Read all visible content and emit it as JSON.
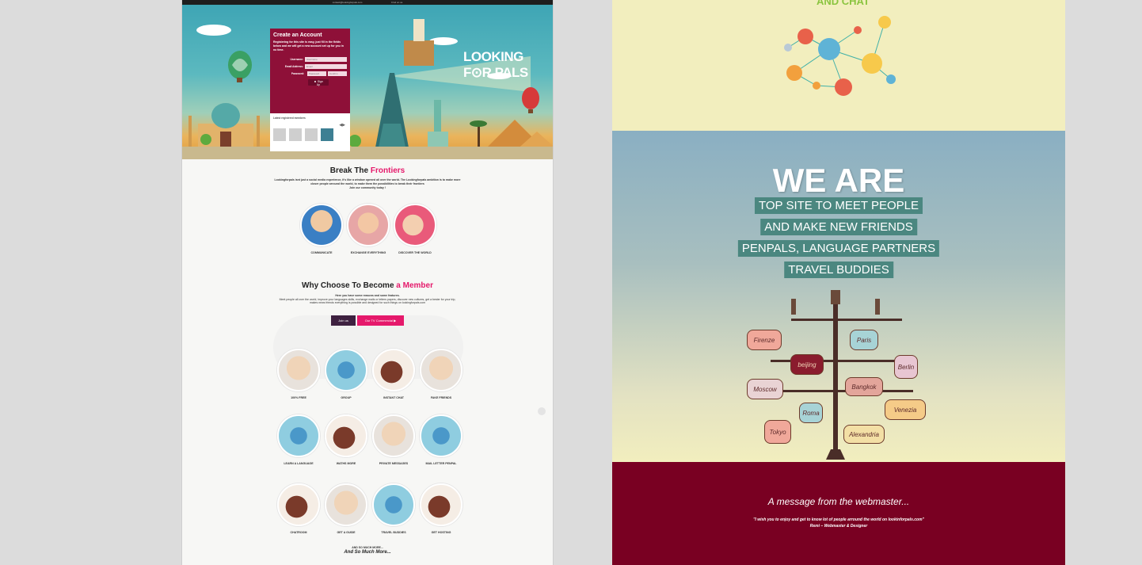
{
  "left_page": {
    "topbar": {
      "email": "contact@lookingforpals.com",
      "find": "Find on us"
    },
    "logo": "LOOKING F⊙R PALS",
    "signup": {
      "title": "Create an Account",
      "intro": "Registering for this site is easy, just fill in the fields below and we will get a new account set up for you in no time.",
      "username_label": "Username:",
      "username_placeholder": "Username",
      "email_label": "Email Address:",
      "email_placeholder": "Email",
      "password_label": "Password:",
      "password_placeholder": "Password",
      "confirm_placeholder": "Confirm",
      "button": "Sign Up"
    },
    "members": {
      "title": "Latest registered members"
    },
    "frontiers": {
      "title_a": "Break The ",
      "title_b": "Frontiers",
      "text": "Lookingforpals isnt just a social media experience, it's like a window opened all over the world. The Lookingforpals ambition is to make more closer people arround the world, to make them the possibilities to break their frontiers",
      "join": "Join our community today !",
      "items": [
        "COMMUNICATE",
        "EXCHANGE EVERYTHING",
        "DISCOVER THE WORLD"
      ]
    },
    "member": {
      "title_a": "Why Choose To Become ",
      "title_b": "a Member",
      "sub": "Here you have some reasons and some features.",
      "text": "Meet people all over the world, improve your languages skills, exchange mails or letters papers, discover new cultures, get a bester for your trip, makes news friends everything is possible and designed for such things on lookingforpals.com",
      "btn_join": "Join us",
      "btn_tv": "Our TV Commercial",
      "features": [
        [
          "100% FREE",
          "GROUP",
          "INSTANT CHAT",
          "FAKE FRIENDS"
        ],
        [
          "LEARN A LANGUAGE",
          "WATHS MORE",
          "PRIVATE MESSAGES",
          "MAIL LETTER PENPAL"
        ],
        [
          "CHATROOM",
          "GET A GUIDE",
          "TRAVEL BUDDIES",
          "GET HOSTING"
        ]
      ],
      "more_a": "AND SO MUCH MORE...",
      "more_b": "And So Much More..."
    }
  },
  "right_page": {
    "top_heading": "AND CHAT",
    "we_are": "WE ARE",
    "tags": [
      "TOP SITE TO MEET PEOPLE",
      "AND MAKE NEW FRIENDS",
      "PENPALS, LANGUAGE PARTNERS",
      "TRAVEL BUDDIES"
    ],
    "signs": [
      "Firenze",
      "Paris",
      "beijing",
      "Berlin",
      "Moscow",
      "Bangkok",
      "Roma",
      "Venezia",
      "Tokyo",
      "Alexandria"
    ],
    "message_title": "A message from  the webmaster...",
    "quote": "\"I wish you to enjoy and get to know lot of people arround the world on lookinforpals.com\"",
    "signature": "Remi – Webmaster & Designer"
  },
  "colors": {
    "accent_pink": "#e5196b",
    "signup_bg": "#8e1038",
    "bottom_bg": "#790022",
    "tag_bg": "#4b8780"
  }
}
